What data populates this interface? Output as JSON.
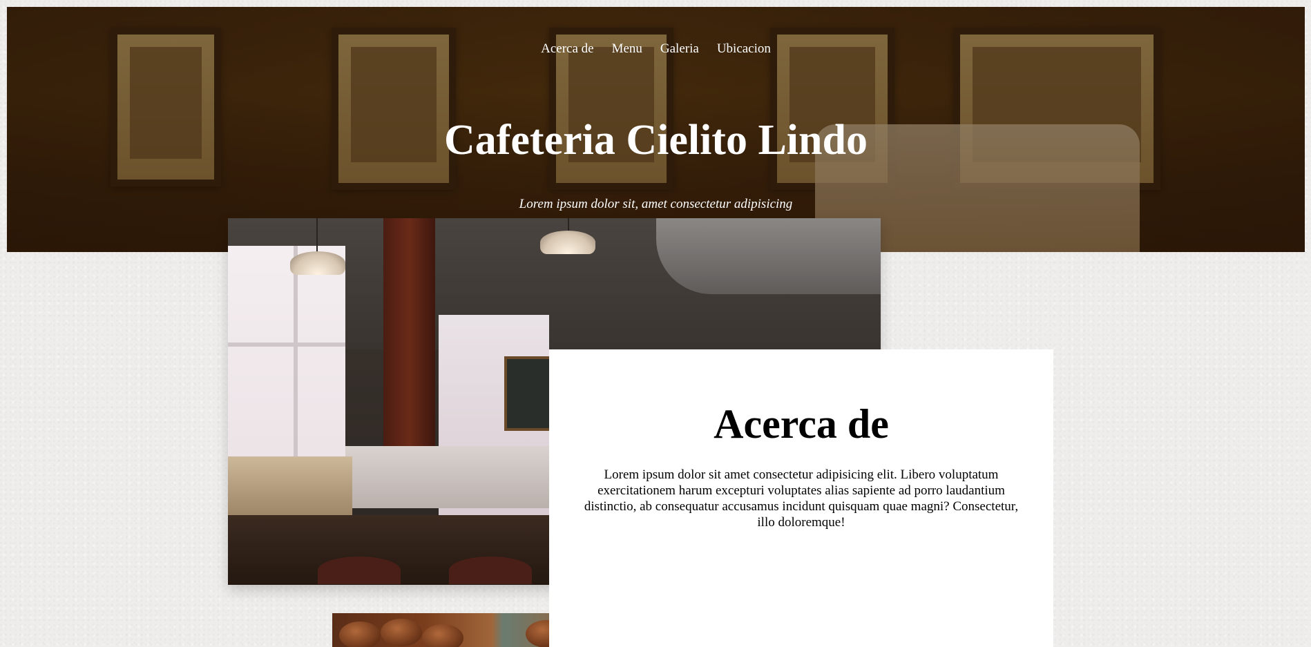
{
  "nav": {
    "items": [
      {
        "label": "Acerca de"
      },
      {
        "label": "Menu"
      },
      {
        "label": "Galeria"
      },
      {
        "label": "Ubicacion"
      }
    ]
  },
  "hero": {
    "title": "Cafeteria Cielito Lindo",
    "subtitle": "Lorem ipsum dolor sit, amet consectetur adipisicing"
  },
  "about": {
    "title": "Acerca de",
    "text": "Lorem ipsum dolor sit amet consectetur adipisicing elit. Libero voluptatum exercitationem harum excepturi voluptates alias sapiente ad porro laudantium distinctio, ab consequatur accusamus incidunt quisquam quae magni? Consectetur, illo doloremque!"
  },
  "colors": {
    "hero_overlay": "#2a1806",
    "page_background": "#eeedeb",
    "card_background": "#ffffff",
    "text_light": "#ffffff",
    "text_dark": "#000000"
  }
}
